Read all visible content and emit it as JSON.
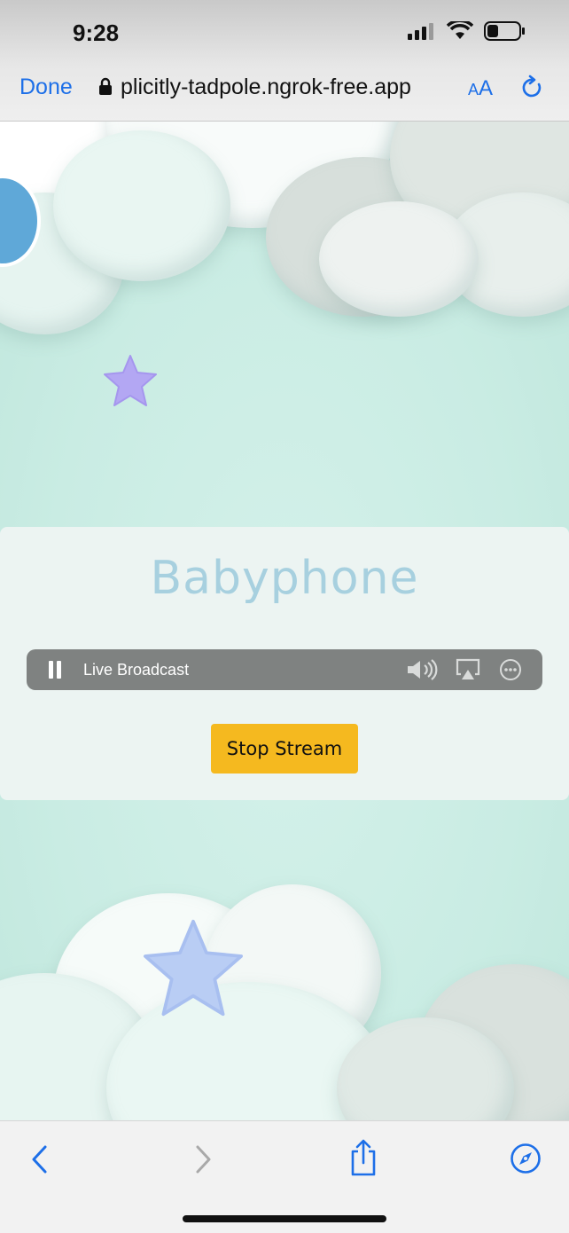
{
  "status_bar": {
    "time": "9:28"
  },
  "url_bar": {
    "done_label": "Done",
    "url": "plicitly-tadpole.ngrok-free.app",
    "text_size_small": "A",
    "text_size_large": "A"
  },
  "page": {
    "title": "Babyphone",
    "player": {
      "label": "Live Broadcast"
    },
    "stop_button": "Stop Stream"
  },
  "colors": {
    "accent": "#1d6fe8",
    "title": "#a7d0df",
    "button": "#f5b91f",
    "player_bg": "#7f8281",
    "background": "#cdeee6"
  },
  "icons": [
    "lock-icon",
    "reload-icon",
    "pause-icon",
    "volume-icon",
    "airplay-icon",
    "more-icon",
    "back-icon",
    "forward-icon",
    "share-icon",
    "compass-icon"
  ]
}
